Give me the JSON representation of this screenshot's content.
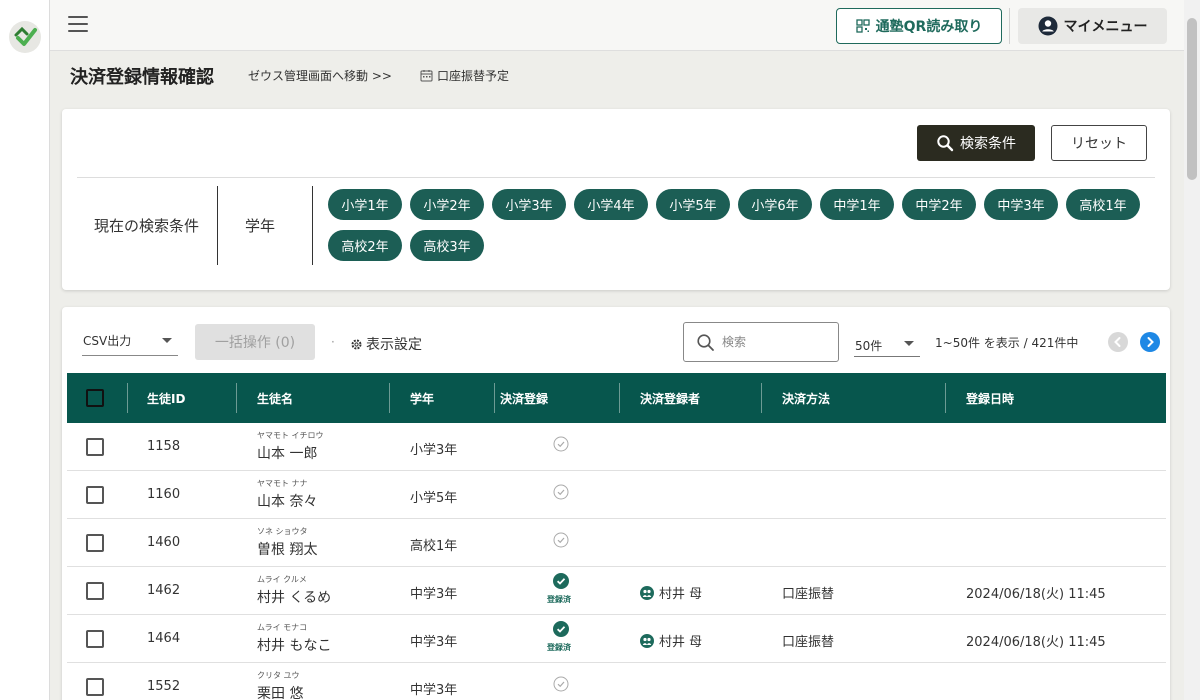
{
  "topbar": {
    "qr_label": "通塾QR読み取り",
    "menu_label": "マイメニュー"
  },
  "page": {
    "title": "決済登録情報確認",
    "zeus_link": "ゼウス管理画面へ移動 >>",
    "schedule_link": "口座振替予定"
  },
  "search": {
    "button_label": "検索条件",
    "reset_label": "リセット",
    "current_label": "現在の検索条件",
    "grade_label": "学年",
    "chips": [
      "小学1年",
      "小学2年",
      "小学3年",
      "小学4年",
      "小学5年",
      "小学6年",
      "中学1年",
      "中学2年",
      "中学3年",
      "高校1年",
      "高校2年",
      "高校3年"
    ]
  },
  "toolbar": {
    "csv_label": "CSV出力",
    "bulk_label": "一括操作 (0)",
    "dot": "·",
    "display_settings": "表示設定",
    "search_placeholder": "検索",
    "per_page": "50件",
    "range_text": "1~50件 を表示 / 421件中"
  },
  "table": {
    "headers": [
      "生徒ID",
      "生徒名",
      "学年",
      "決済登録",
      "決済登録者",
      "決済方法",
      "登録日時"
    ],
    "rows": [
      {
        "id": "1158",
        "kana": "ヤマモト イチロウ",
        "name": "山本 一郎",
        "grade": "小学3年",
        "registered": false,
        "status": "",
        "payer": "",
        "method": "",
        "date": ""
      },
      {
        "id": "1160",
        "kana": "ヤマモト ナナ",
        "name": "山本 奈々",
        "grade": "小学5年",
        "registered": false,
        "status": "",
        "payer": "",
        "method": "",
        "date": ""
      },
      {
        "id": "1460",
        "kana": "ソネ ショウタ",
        "name": "曽根 翔太",
        "grade": "高校1年",
        "registered": false,
        "status": "",
        "payer": "",
        "method": "",
        "date": ""
      },
      {
        "id": "1462",
        "kana": "ムライ クルメ",
        "name": "村井 くるめ",
        "grade": "中学3年",
        "registered": true,
        "status": "登録済",
        "payer": "村井 母",
        "method": "口座振替",
        "date": "2024/06/18(火) 11:45"
      },
      {
        "id": "1464",
        "kana": "ムライ モナコ",
        "name": "村井 もなこ",
        "grade": "中学3年",
        "registered": true,
        "status": "登録済",
        "payer": "村井 母",
        "method": "口座振替",
        "date": "2024/06/18(火) 11:45"
      },
      {
        "id": "1552",
        "kana": "クリタ ユウ",
        "name": "栗田 悠",
        "grade": "中学3年",
        "registered": false,
        "status": "",
        "payer": "",
        "method": "",
        "date": ""
      }
    ]
  },
  "colors": {
    "brand": "#1c5e55",
    "header": "#07564d",
    "accent_blue": "#1e88e5"
  }
}
